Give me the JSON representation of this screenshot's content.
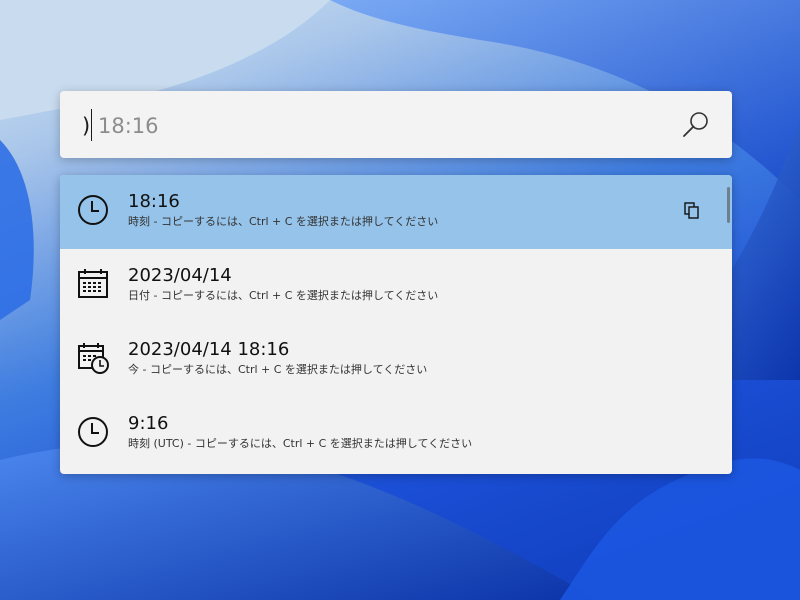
{
  "search": {
    "typed_prefix": ")",
    "suggestion_text": "18:16"
  },
  "results": [
    {
      "title": "18:16",
      "subtitle": "時刻 - コピーするには、Ctrl + C を選択または押してください",
      "icon": "clock-icon",
      "selected": true
    },
    {
      "title": "2023/04/14",
      "subtitle": "日付 - コピーするには、Ctrl + C を選択または押してください",
      "icon": "calendar-icon",
      "selected": false
    },
    {
      "title": "2023/04/14 18:16",
      "subtitle": "今 - コピーするには、Ctrl + C を選択または押してください",
      "icon": "calendar-clock-icon",
      "selected": false
    },
    {
      "title": "9:16",
      "subtitle": "時刻 (UTC) - コピーするには、Ctrl + C を選択または押してください",
      "icon": "clock-icon",
      "selected": false
    }
  ],
  "colors": {
    "selected_row": "#95c3e9",
    "panel_background": "#f2f2f2"
  }
}
